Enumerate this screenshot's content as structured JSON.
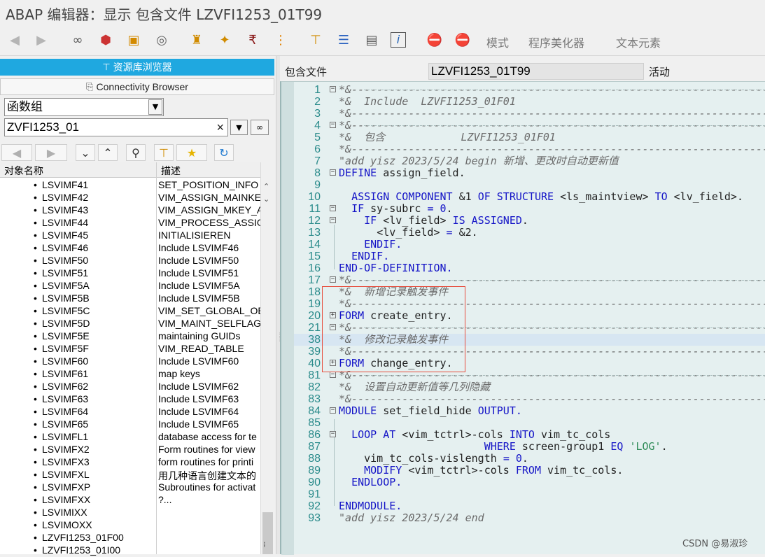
{
  "window": {
    "title": "ABAP 编辑器：显示 包含文件 LZVFI1253_01T99"
  },
  "toolbar": {
    "back_icon": "arrow-left-icon",
    "forward_icon": "arrow-right-icon",
    "text_items": [
      "模式",
      "程序美化器",
      "文本元素"
    ]
  },
  "left": {
    "repo_browser_label": "资源库浏览器",
    "connectivity_label": "Connectivity Browser",
    "object_type": "函数组",
    "object_name": "ZVFI1253_01",
    "clear_symbol": "×",
    "table_headers": {
      "name": "对象名称",
      "desc": "描述"
    },
    "rows": [
      {
        "name": "LSVIMF41",
        "desc": "SET_POSITION_INFO"
      },
      {
        "name": "LSVIMF42",
        "desc": "VIM_ASSIGN_MAINKEY"
      },
      {
        "name": "LSVIMF43",
        "desc": "VIM_ASSIGN_MKEY_A"
      },
      {
        "name": "LSVIMF44",
        "desc": "VIM_PROCESS_ASSIG"
      },
      {
        "name": "LSVIMF45",
        "desc": "INITIALISIEREN"
      },
      {
        "name": "LSVIMF46",
        "desc": "Include LSVIMF46"
      },
      {
        "name": "LSVIMF50",
        "desc": "Include LSVIMF50"
      },
      {
        "name": "LSVIMF51",
        "desc": "Include LSVIMF51"
      },
      {
        "name": "LSVIMF5A",
        "desc": "Include LSVIMF5A"
      },
      {
        "name": "LSVIMF5B",
        "desc": "Include LSVIMF5B"
      },
      {
        "name": "LSVIMF5C",
        "desc": "VIM_SET_GLOBAL_OB"
      },
      {
        "name": "LSVIMF5D",
        "desc": "VIM_MAINT_SELFLAG"
      },
      {
        "name": "LSVIMF5E",
        "desc": "maintaining GUIDs"
      },
      {
        "name": "LSVIMF5F",
        "desc": "VIM_READ_TABLE"
      },
      {
        "name": "LSVIMF60",
        "desc": "Include LSVIMF60"
      },
      {
        "name": "LSVIMF61",
        "desc": "map keys"
      },
      {
        "name": "LSVIMF62",
        "desc": "Include LSVIMF62"
      },
      {
        "name": "LSVIMF63",
        "desc": "Include LSVIMF63"
      },
      {
        "name": "LSVIMF64",
        "desc": "Include LSVIMF64"
      },
      {
        "name": "LSVIMF65",
        "desc": "Include LSVIMF65"
      },
      {
        "name": "LSVIMFL1",
        "desc": "database access for te"
      },
      {
        "name": "LSVIMFX2",
        "desc": "Form routines for view"
      },
      {
        "name": "LSVIMFX3",
        "desc": "form routines for printi"
      },
      {
        "name": "LSVIMFXL",
        "desc": "用几种语言创建文本的"
      },
      {
        "name": "LSVIMFXP",
        "desc": "Subroutines for activat"
      },
      {
        "name": "LSVIMFXX",
        "desc": "?..."
      },
      {
        "name": "LSVIMIXX",
        "desc": ""
      },
      {
        "name": "LSVIMOXX",
        "desc": ""
      },
      {
        "name": "LZVFI1253_01F00",
        "desc": ""
      },
      {
        "name": "LZVFI1253_01I00",
        "desc": ""
      }
    ]
  },
  "header": {
    "label": "包含文件",
    "include_name": "LZVFI1253_01T99",
    "status": "活动"
  },
  "code": {
    "l1": "*&---------------------------------------------------------------------",
    "l2": "*&  Include  LZVFI1253_01F01",
    "l3": "*&---------------------------------------------------------------------",
    "l4": "*&---------------------------------------------------------------------",
    "l5": "*&  包含            LZVFI1253_01F01",
    "l6": "*&---------------------------------------------------------------------",
    "l7": "\"add yisz 2023/5/24 begin 新增、更改时自动更新值",
    "l8a": "DEFINE",
    "l8b": " assign_field.",
    "l10a": "ASSIGN COMPONENT",
    "l10b": " &1 ",
    "l10c": "OF STRUCTURE",
    "l10d": " <ls_maintview> ",
    "l10e": "TO",
    "l10f": " <lv_field>.",
    "l11a": "IF",
    "l11b": " sy-subrc ",
    "l11c": "=",
    "l11d": " ",
    "l11e": "0",
    "l11f": ".",
    "l12a": "IF",
    "l12b": " <lv_field> ",
    "l12c": "IS ASSIGNED",
    "l12d": ".",
    "l13a": "<lv_field> ",
    "l13b": "=",
    "l13c": " &2.",
    "l14": "ENDIF.",
    "l15": "ENDIF.",
    "l16": "END-OF-DEFINITION.",
    "l17": "*&---------------------------------------------------------------------",
    "l18": "*&  新增记录触发事件",
    "l19": "*&---------------------------------------------------------------------",
    "l20a": "FORM",
    "l20b": " create_entry.",
    "l21": "*&---------------------------------------------------------------------",
    "l38": "*&  修改记录触发事件",
    "l39": "*&---------------------------------------------------------------------",
    "l40a": "FORM",
    "l40b": " change_entry.",
    "l81": "*&---------------------------------------------------------------------",
    "l82": "*&  设置自动更新值等几列隐藏",
    "l83": "*&---------------------------------------------------------------------",
    "l84a": "MODULE",
    "l84b": " set_field_hide ",
    "l84c": "OUTPUT.",
    "l86a": "LOOP AT",
    "l86b": " <vim_tctrl>-cols ",
    "l86c": "INTO",
    "l86d": " vim_tc_cols",
    "l87a": "WHERE",
    "l87b": " screen-group1 ",
    "l87c": "EQ",
    "l87d": " ",
    "l87e": "'LOG'",
    "l87f": ".",
    "l88a": "vim_tc_cols-vislength ",
    "l88b": "=",
    "l88c": " ",
    "l88d": "0",
    "l88e": ".",
    "l89a": "MODIFY",
    "l89b": " <vim_tctrl>-cols ",
    "l89c": "FROM",
    "l89d": " vim_tc_cols.",
    "l90": "ENDLOOP.",
    "l92": "ENDMODULE.",
    "l93": "\"add yisz 2023/5/24 end"
  },
  "line_numbers": [
    "1",
    "2",
    "3",
    "4",
    "5",
    "6",
    "7",
    "8",
    "9",
    "10",
    "11",
    "12",
    "13",
    "14",
    "15",
    "16",
    "17",
    "18",
    "19",
    "20",
    "21",
    "38",
    "39",
    "40",
    "81",
    "82",
    "83",
    "84",
    "85",
    "86",
    "87",
    "88",
    "89",
    "90",
    "91",
    "92",
    "93"
  ],
  "watermark": "CSDN @易淑珍"
}
